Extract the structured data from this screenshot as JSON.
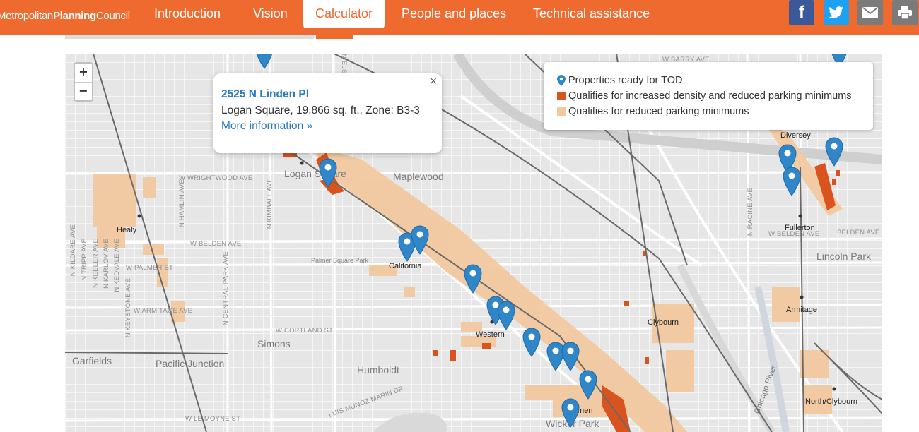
{
  "header": {
    "logo_prefix": "Metropolitan",
    "logo_bold": "Planning",
    "logo_suffix": "Council",
    "nav": [
      "Introduction",
      "Vision",
      "Calculator",
      "People and places",
      "Technical assistance"
    ],
    "active_nav": "Calculator",
    "share_icons": [
      "facebook-icon",
      "twitter-icon",
      "email-icon",
      "print-icon"
    ],
    "colors": {
      "brand": "#ee6a2f",
      "facebook": "#3b5998",
      "twitter": "#1da1f2",
      "email": "#7b7b7b",
      "print": "#7b7b7b"
    }
  },
  "map": {
    "zoom_in": "+",
    "zoom_out": "−",
    "popup": {
      "title": "2525 N Linden Pl",
      "description": "Logan Square, 19,866 sq. ft., Zone: B3-3",
      "link": "More information »",
      "close": "×"
    },
    "legend": {
      "items": [
        {
          "label": "Properties ready for TOD",
          "icon": "map-marker-icon",
          "color": "#2f86c8"
        },
        {
          "label": "Qualifies for increased density and reduced parking minimums",
          "color": "#d9531e"
        },
        {
          "label": "Qualifies for reduced parking minimums",
          "color": "#f2c9a0"
        }
      ]
    },
    "neighborhoods": [
      "Logan Square",
      "Maplewood",
      "Simons",
      "Pacific Junction",
      "Humboldt",
      "Lincoln Park",
      "Wicker Park",
      "Garfields"
    ],
    "stations": [
      "Healy",
      "California",
      "Western",
      "Damen",
      "Fullerton",
      "Armitage",
      "Clybourn",
      "North/Clybourn",
      "Diversey"
    ],
    "streets": [
      "W WRIGHTWOOD AVE",
      "W BELDEN AVE",
      "W PALMER ST",
      "W ARMITAGE AVE",
      "W CORTLAND ST",
      "W LE MOYNE ST",
      "W BELDEN AVE",
      "BELDEN AVE",
      "N HAMLIN AVE",
      "N KIMBALL AVE",
      "N CENTRAL PARK AVE",
      "N RACINE AVE",
      "N KILDARE AVE",
      "N KEELER AVE",
      "N KARLOV AVE",
      "N KEDVALE AVE",
      "N KEYSTONE AVE",
      "N TRIPP AVE",
      "W BARRY AVE",
      "N ELSTON AVE"
    ],
    "parks": [
      "Palmer Square Park"
    ],
    "other_labels": [
      "LUIS MUNOZ MARIN DR",
      "Chicago River"
    ],
    "marker_color": "#2f86c8"
  }
}
